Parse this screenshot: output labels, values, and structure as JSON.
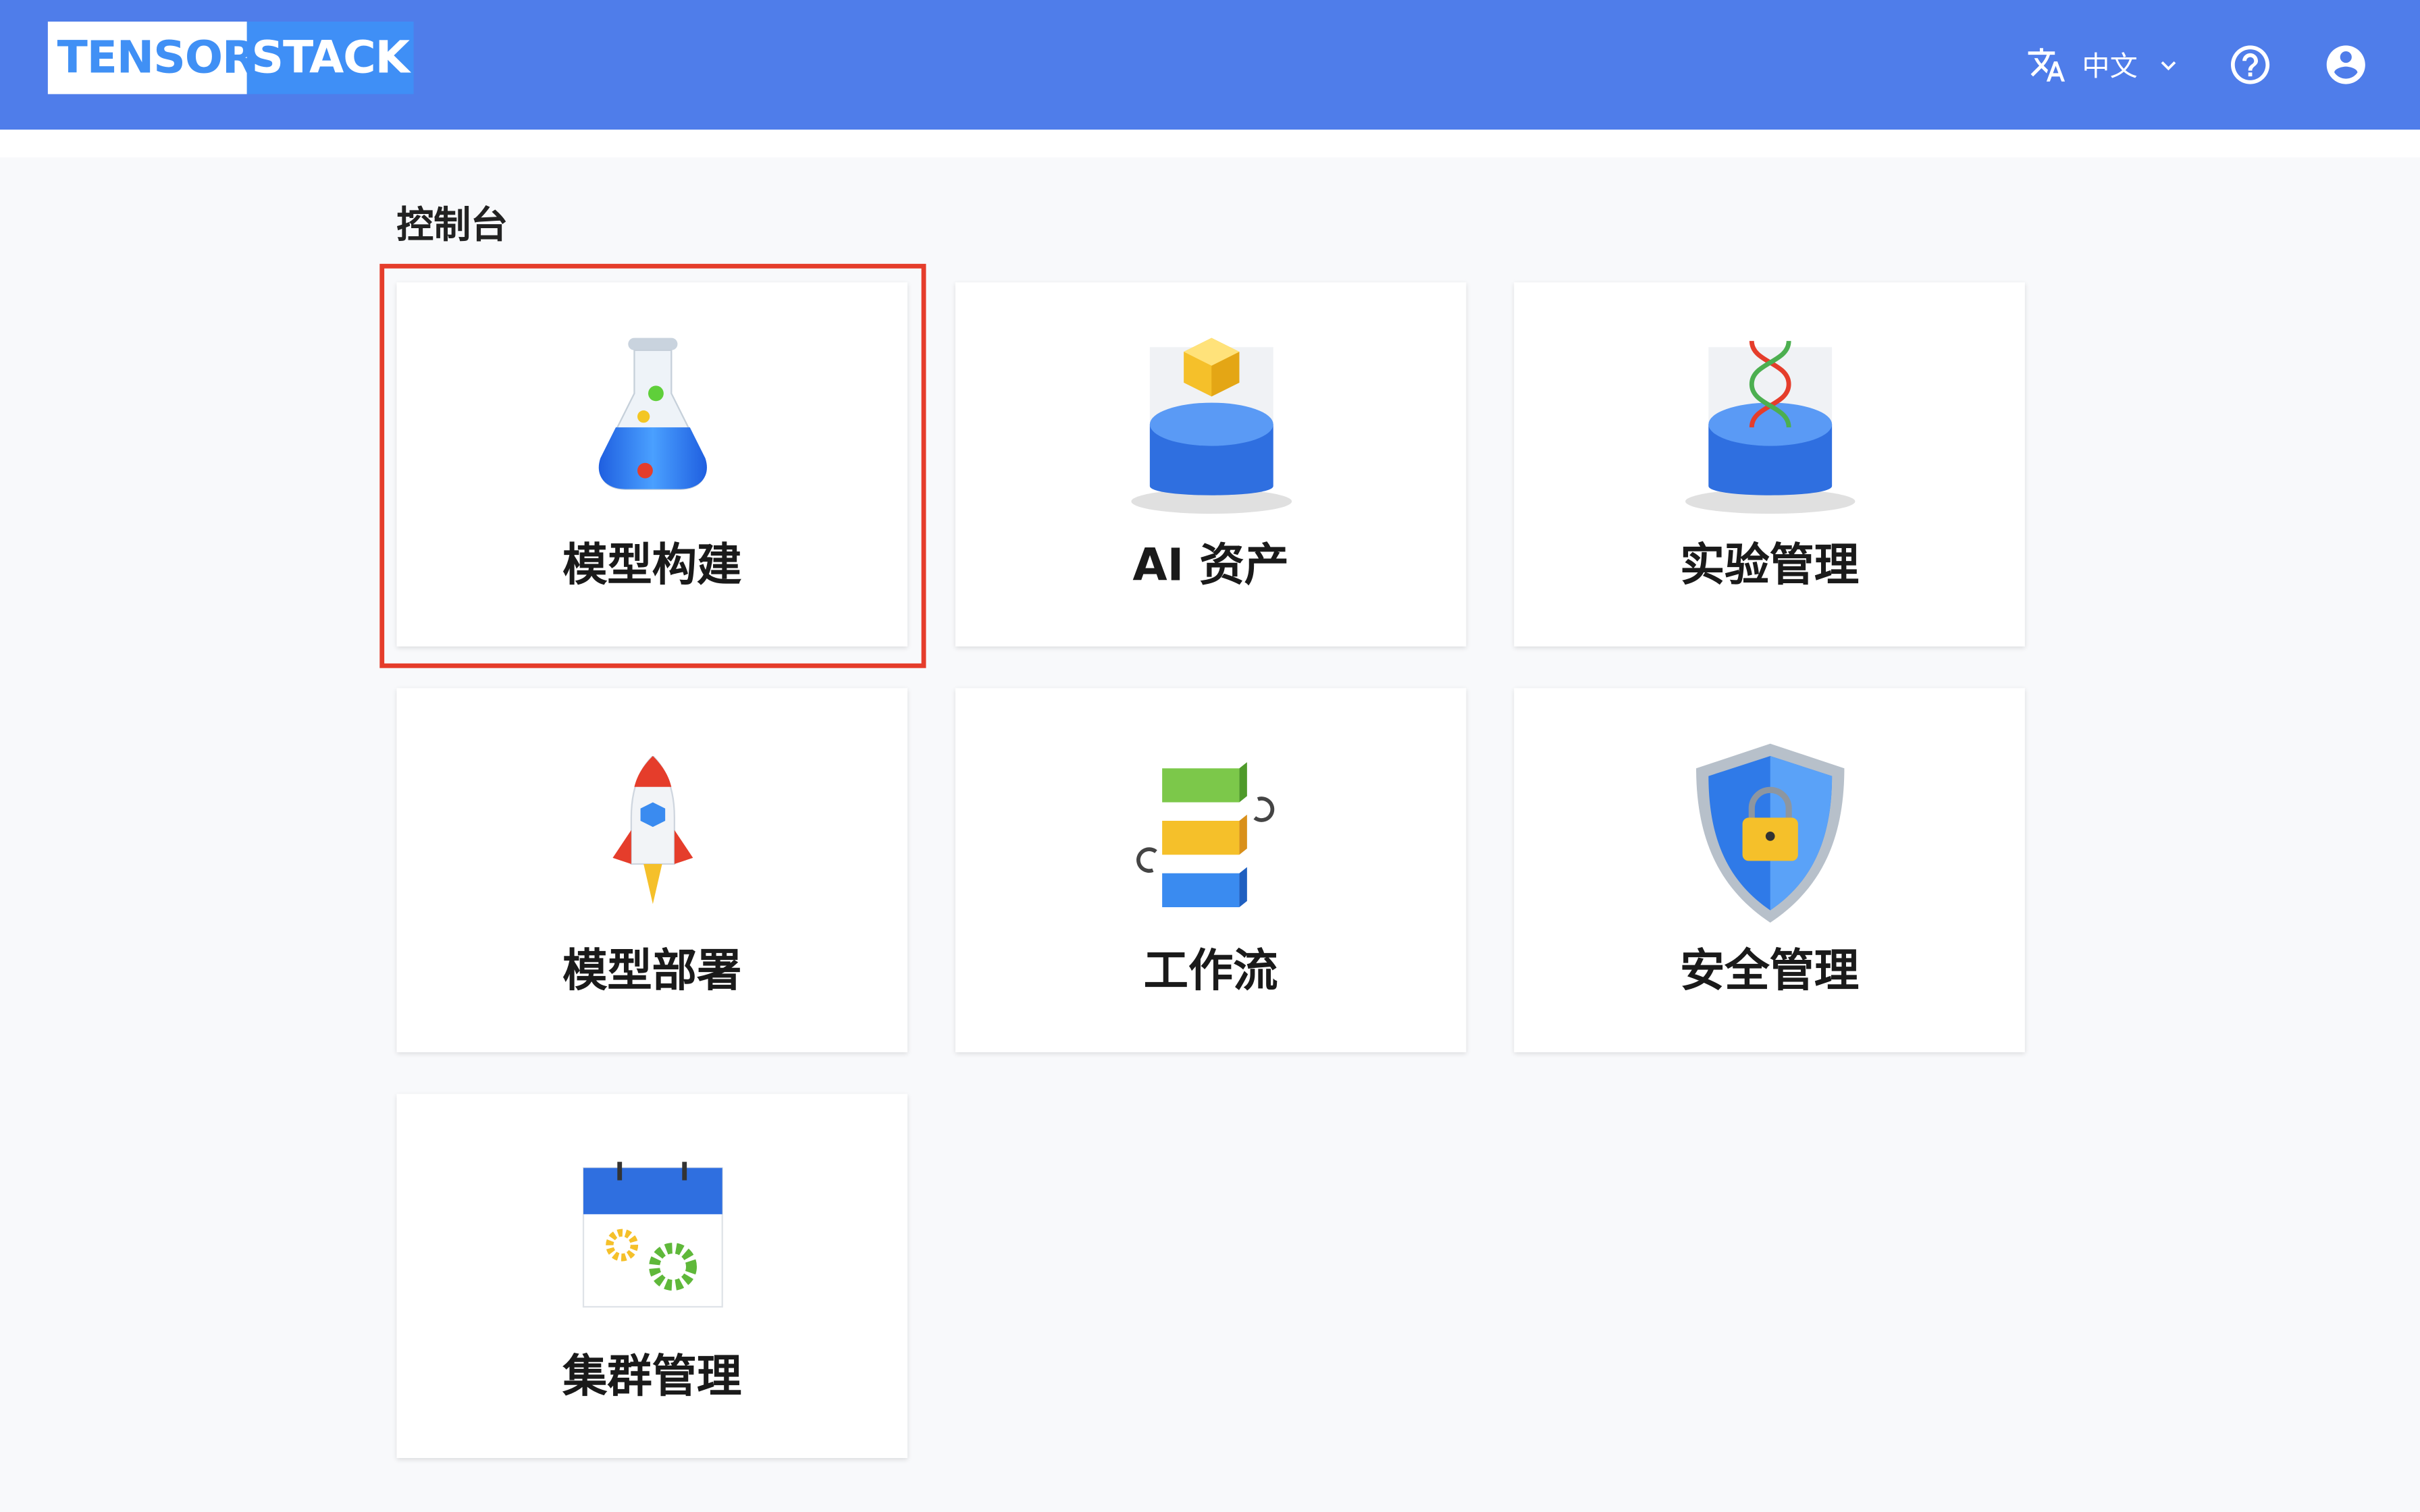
{
  "header": {
    "logo": {
      "left": "TENSOR",
      "right": "STACK"
    },
    "language": {
      "icon": "translate-icon",
      "label": "中文",
      "chevron": "chevron-down-icon"
    },
    "help_icon": "help-circle-icon",
    "user_icon": "account-circle-icon",
    "colors": {
      "bar": "#4f7dea",
      "logo_blue": "#3f8ff6"
    }
  },
  "main": {
    "title": "控制台",
    "selected_card": "模型构建",
    "selection_color": "#e53d2b",
    "cards": [
      {
        "label": "模型构建",
        "icon": "flask-icon"
      },
      {
        "label": "AI 资产",
        "icon": "cube-database-icon"
      },
      {
        "label": "实验管理",
        "icon": "dna-database-icon"
      },
      {
        "label": "模型部署",
        "icon": "rocket-icon"
      },
      {
        "label": "工作流",
        "icon": "workflow-blocks-icon"
      },
      {
        "label": "安全管理",
        "icon": "shield-lock-icon"
      },
      {
        "label": "集群管理",
        "icon": "calendar-gears-icon"
      }
    ]
  }
}
